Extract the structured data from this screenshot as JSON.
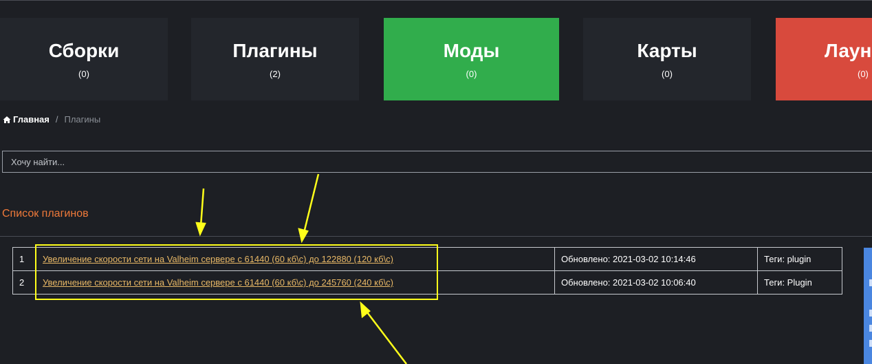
{
  "categories": [
    {
      "title": "Сборки",
      "count": "(0)"
    },
    {
      "title": "Плагины",
      "count": "(2)"
    },
    {
      "title": "Моды",
      "count": "(0)"
    },
    {
      "title": "Карты",
      "count": "(0)"
    },
    {
      "title": "Лаунчеры",
      "count": "(0)"
    }
  ],
  "colors": {
    "active_tile": "#31ad4c",
    "launcher_tile": "#d84a3d",
    "link": "#e8b866",
    "section_title": "#f07a3a",
    "annotation": "#ffff1a"
  },
  "breadcrumb": {
    "home_icon": "home-icon",
    "home": "Главная",
    "separator": "/",
    "current": "Плагины"
  },
  "search": {
    "placeholder": "Хочу найти..."
  },
  "section_title": "Список плагинов",
  "plugins": [
    {
      "num": "1",
      "title": "Увеличение скорости сети на Valheim сервере с 61440 (60 кб\\с) до 122880 (120 кб\\с)",
      "updated": "Обновлено: 2021-03-02 10:14:46",
      "tags": "Теги: plugin"
    },
    {
      "num": "2",
      "title": "Увеличение скорости сети на Valheim сервере с 61440 (60 кб\\с) до 245760 (240 кб\\с)",
      "updated": "Обновлено: 2021-03-02 10:06:40",
      "tags": "Теги: Plugin"
    }
  ]
}
